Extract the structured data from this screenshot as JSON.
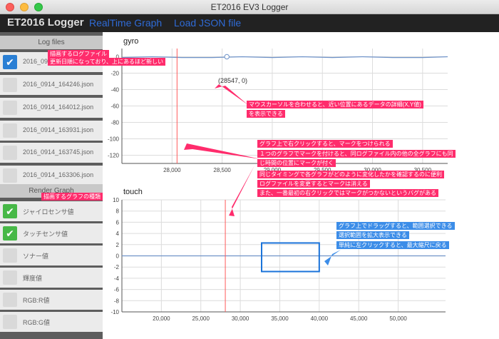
{
  "window": {
    "title": "ET2016 EV3 Logger"
  },
  "navbar": {
    "brand": "ET2016 Logger",
    "links": [
      "RealTime Graph",
      "Load JSON file"
    ]
  },
  "sidebar": {
    "log_files_header": "Log files",
    "log_files": [
      {
        "label": "2016_0914",
        "checked": true
      },
      {
        "label": "2016_0914_164246.json",
        "checked": false
      },
      {
        "label": "2016_0914_164012.json",
        "checked": false
      },
      {
        "label": "2016_0914_163931.json",
        "checked": false
      },
      {
        "label": "2016_0914_163745.json",
        "checked": false
      },
      {
        "label": "2016_0914_163306.json",
        "checked": false
      }
    ],
    "render_graph_header": "Render Graph",
    "graphs": [
      {
        "label": "ジャイロセンサ値",
        "checked": true
      },
      {
        "label": "タッチセンサ値",
        "checked": true
      },
      {
        "label": "ソナー値",
        "checked": false
      },
      {
        "label": "輝度値",
        "checked": false
      },
      {
        "label": "RGB:R値",
        "checked": false
      },
      {
        "label": "RGB:G値",
        "checked": false
      }
    ]
  },
  "colors": {
    "annotation": "#ff2c6c",
    "annotation_blue": "#3c8de8",
    "series": "#6f93c9",
    "marker": "#ff5a5a",
    "selection": "#1a73d9"
  },
  "annotations": {
    "log_file_1": "描画するログファイル",
    "log_file_2": "更新日順になっており、上にあるほど新しい",
    "graph_type": "描画するグラフの種類",
    "hover_1": "マウスカーソルを合わせると、近い位置にあるデータの詳細(X,Y値)",
    "hover_2": "を表示できる",
    "mark_1": "グラフ上で右クリックすると、マークをつけられる",
    "mark_2": "１つのグラフでマークを付けると、同ログファイル内の他の全グラフにも同",
    "mark_3": "じ時間の位置にマークが付く",
    "mark_4": "同じタイミングで各グラフがどのように変化したかを確認するのに便利",
    "mark_5": "ログファイルを変更するとマークは消える",
    "mark_6": "また、一番最初の右クリックではマークがつかないというバグがある",
    "zoom_1": "グラフ上でドラッグすると、範囲選択できる",
    "zoom_2": "選択範囲を拡大表示できる",
    "zoom_3": "単純に左クリックすると、最大縮尺に戻る"
  },
  "tooltip": "(28547, 0)",
  "chart_data": [
    {
      "type": "line",
      "title": "gyro",
      "xlim": [
        27500,
        30750
      ],
      "ylim": [
        -130,
        10
      ],
      "x_ticks": [
        28000,
        28500,
        29000,
        29500,
        30000,
        30500
      ],
      "x_tick_labels": [
        "28,000",
        "28,500",
        "29,000",
        "29,500",
        "30,000",
        "30,500"
      ],
      "y_ticks": [
        0,
        -20,
        -40,
        -60,
        -80,
        -100,
        -120
      ],
      "y_tick_labels": [
        "0",
        "-20",
        "-40",
        "-60",
        "-80",
        "-100",
        "-120"
      ],
      "grid": true,
      "marker_x": 28050,
      "hover_point": [
        28547,
        0
      ],
      "series": [
        {
          "x": [
            27500,
            27800,
            28100,
            28400,
            28700,
            29000,
            29300,
            29600,
            29900,
            30200,
            30500,
            30750
          ],
          "y": [
            -1,
            0,
            -1,
            -1,
            0,
            -1,
            0,
            -1,
            0,
            -1,
            -1,
            0
          ]
        }
      ]
    },
    {
      "type": "line",
      "title": "touch",
      "xlim": [
        15000,
        56000
      ],
      "ylim": [
        -10,
        10
      ],
      "x_ticks": [
        20000,
        25000,
        30000,
        35000,
        40000,
        45000,
        50000
      ],
      "x_tick_labels": [
        "20,000",
        "25,000",
        "30,000",
        "35,000",
        "40,000",
        "45,000",
        "50,000"
      ],
      "y_ticks": [
        10,
        8,
        6,
        4,
        2,
        0,
        -2,
        -4,
        -6,
        -8,
        -10
      ],
      "y_tick_labels": [
        "10",
        "8",
        "6",
        "4",
        "2",
        "0",
        "-2",
        "-4",
        "-6",
        "-8",
        "-10"
      ],
      "grid": true,
      "marker_x": 28100,
      "selection": {
        "x": [
          32700,
          40000
        ],
        "y": [
          2.3,
          -2.8
        ]
      },
      "series": [
        {
          "x": [
            15000,
            56000
          ],
          "y": [
            0,
            0
          ]
        }
      ]
    }
  ]
}
